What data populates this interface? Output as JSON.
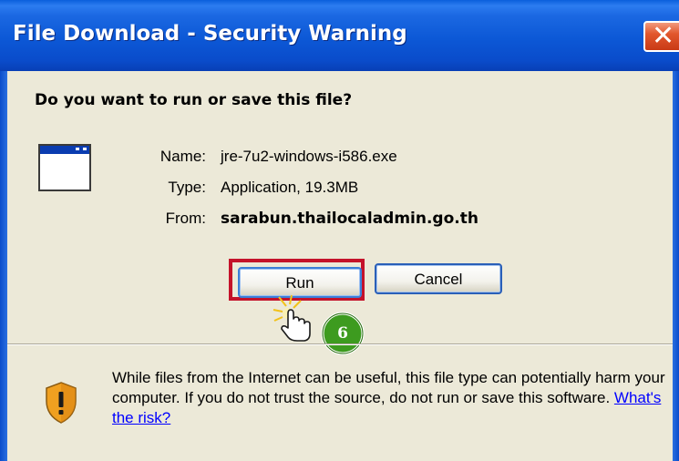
{
  "window": {
    "title": "File Download - Security Warning",
    "close_icon": "close-icon"
  },
  "dialog": {
    "heading": "Do you want to run or save this file?",
    "file_icon": "application-window-icon",
    "fields": {
      "name_label": "Name:",
      "name_value": "jre-7u2-windows-i586.exe",
      "type_label": "Type:",
      "type_value": "Application, 19.3MB",
      "from_label": "From:",
      "from_value": "sarabun.thailocaladmin.go.th"
    },
    "buttons": {
      "run_label": "Run",
      "cancel_label": "Cancel"
    },
    "warning": {
      "icon": "security-shield-icon",
      "text": "While files from the Internet can be useful, this file type can potentially harm your computer. If you do not trust the source, do not run or save this software. ",
      "link_text": "What's the risk?"
    }
  },
  "annotation": {
    "step_number": "6",
    "highlight_color": "#c4122a",
    "badge_color": "#3d9b1f",
    "cursor_icon": "hand-pointer-icon"
  },
  "colors": {
    "titlebar": "#0a58d6",
    "client_bg": "#ece9d8",
    "link": "#0000ff"
  }
}
